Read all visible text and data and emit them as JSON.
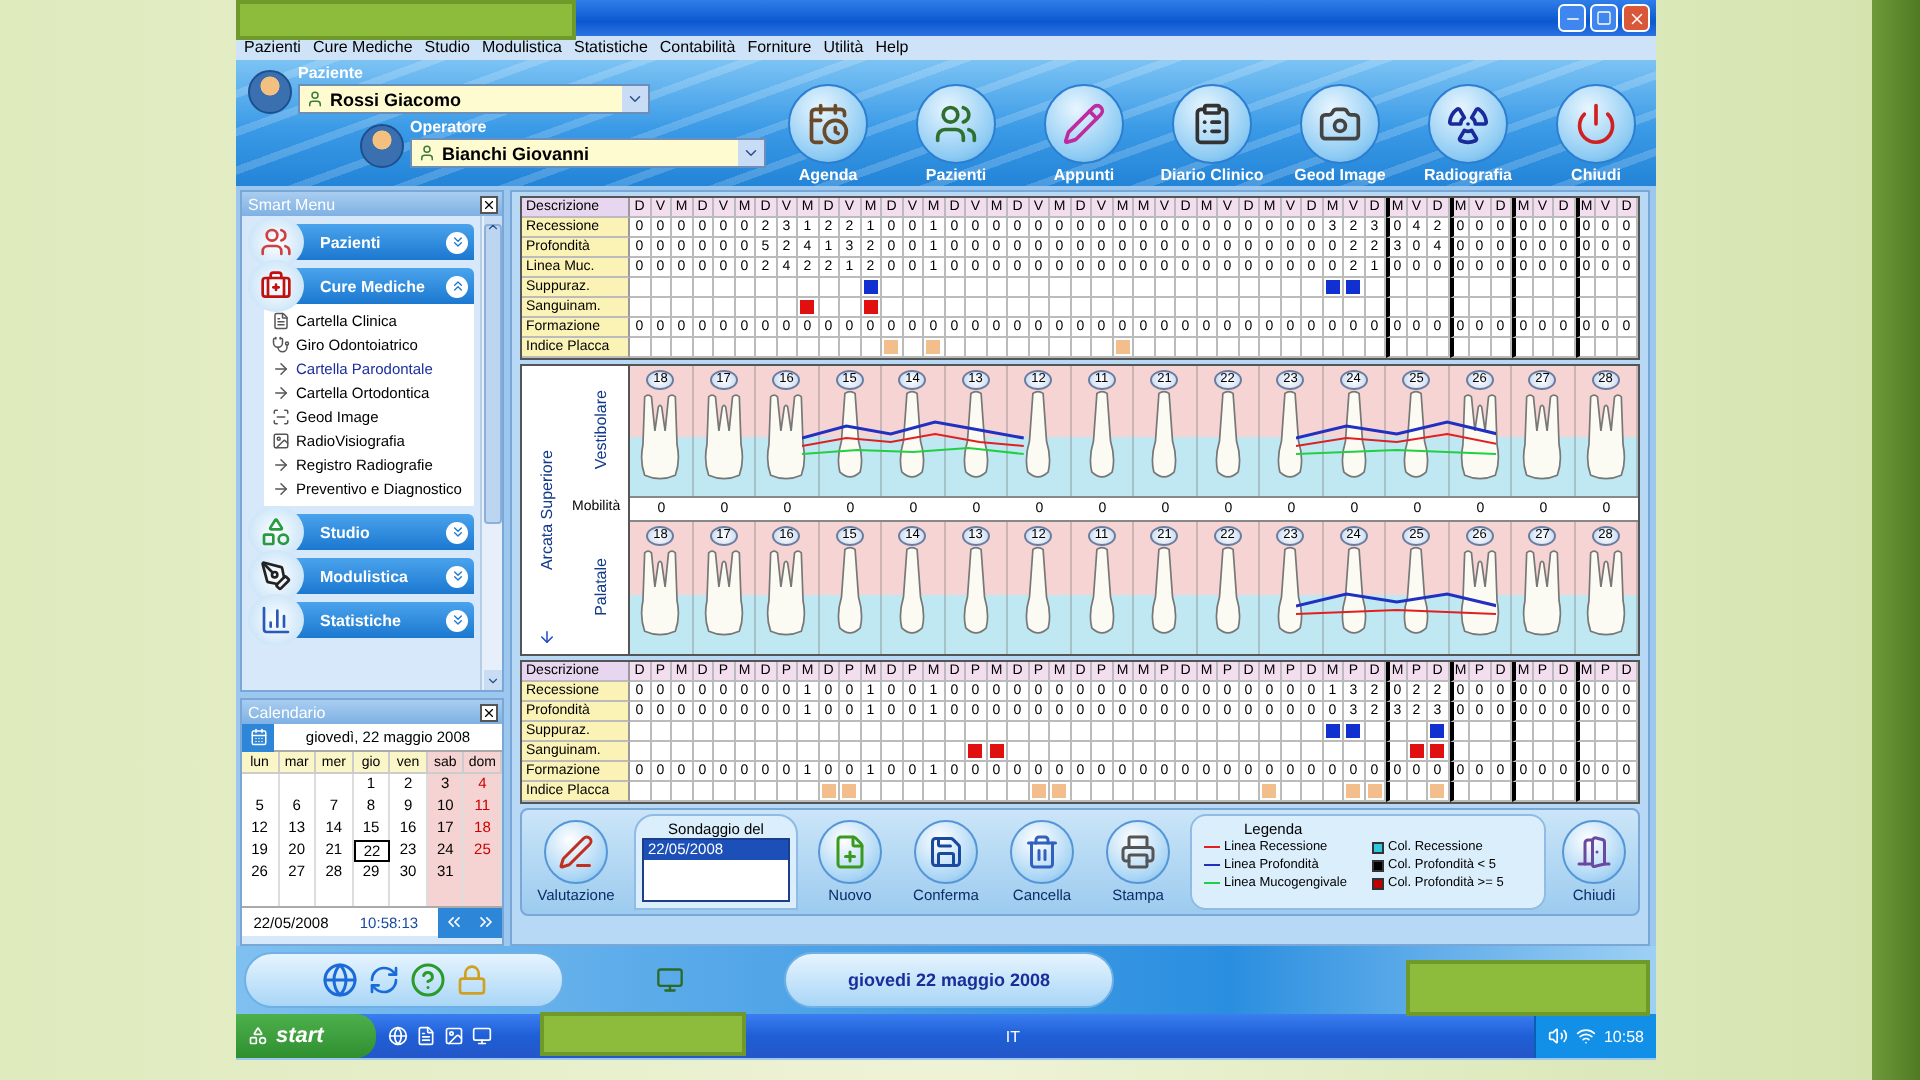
{
  "menu": [
    "Pazienti",
    "Cure Mediche",
    "Studio",
    "Modulistica",
    "Statistiche",
    "Contabilità",
    "Forniture",
    "Utilità",
    "Help"
  ],
  "patient": {
    "label": "Paziente",
    "value": "Rossi Giacomo"
  },
  "operator": {
    "label": "Operatore",
    "value": "Bianchi Giovanni"
  },
  "toolbar": [
    {
      "label": "Agenda",
      "kind": "agenda"
    },
    {
      "label": "Pazienti",
      "kind": "patients"
    },
    {
      "label": "Appunti",
      "kind": "notes"
    },
    {
      "label": "Diario Clinico",
      "kind": "diary"
    },
    {
      "label": "Geod Image",
      "kind": "camera"
    },
    {
      "label": "Radiografia",
      "kind": "xray"
    },
    {
      "label": "Chiudi",
      "kind": "close"
    }
  ],
  "smart_menu": {
    "title": "Smart Menu",
    "groups": [
      {
        "label": "Pazienti",
        "kind": "patients",
        "expanded": false
      },
      {
        "label": "Cure Mediche",
        "kind": "medical",
        "expanded": true,
        "items": [
          {
            "label": "Cartella Clinica",
            "kind": "folder",
            "selected": false
          },
          {
            "label": "Giro Odontoiatrico",
            "kind": "probe",
            "selected": false
          },
          {
            "label": "Cartella Parodontale",
            "kind": "link",
            "selected": true
          },
          {
            "label": "Cartella Ortodontica",
            "kind": "link",
            "selected": false
          },
          {
            "label": "Geod Image",
            "kind": "scan",
            "selected": false
          },
          {
            "label": "RadioVisiografia",
            "kind": "xray",
            "selected": false
          },
          {
            "label": "Registro Radiografie",
            "kind": "link",
            "selected": false
          },
          {
            "label": "Preventivo e Diagnostico",
            "kind": "link",
            "selected": false
          }
        ]
      },
      {
        "label": "Studio",
        "kind": "studio",
        "expanded": false
      },
      {
        "label": "Modulistica",
        "kind": "forms",
        "expanded": false
      },
      {
        "label": "Statistiche",
        "kind": "stats",
        "expanded": false
      }
    ]
  },
  "calendar": {
    "title": "Calendario",
    "heading": "giovedì, 22 maggio 2008",
    "weekdays": [
      "lun",
      "mar",
      "mer",
      "gio",
      "ven",
      "sab",
      "dom"
    ],
    "weeks": [
      [
        {
          "kind": "empty"
        },
        {
          "kind": "empty"
        },
        {
          "kind": "empty"
        },
        {
          "day": "1",
          "selected": false
        },
        {
          "day": "2",
          "selected": false
        },
        {
          "day": "3",
          "selected": false
        },
        {
          "day": "4",
          "selected": false
        }
      ],
      [
        {
          "day": "5",
          "selected": false
        },
        {
          "day": "6",
          "selected": false
        },
        {
          "day": "7",
          "selected": false
        },
        {
          "day": "8",
          "selected": false
        },
        {
          "day": "9",
          "selected": false
        },
        {
          "day": "10",
          "selected": false
        },
        {
          "day": "11",
          "selected": false
        }
      ],
      [
        {
          "day": "12",
          "selected": false
        },
        {
          "day": "13",
          "selected": false
        },
        {
          "day": "14",
          "selected": false
        },
        {
          "day": "15",
          "selected": false
        },
        {
          "day": "16",
          "selected": false
        },
        {
          "day": "17",
          "selected": false
        },
        {
          "day": "18",
          "selected": false
        }
      ],
      [
        {
          "day": "19",
          "selected": false
        },
        {
          "day": "20",
          "selected": false
        },
        {
          "day": "21",
          "selected": false
        },
        {
          "day": "22",
          "selected": true
        },
        {
          "day": "23",
          "selected": false
        },
        {
          "day": "24",
          "selected": false
        },
        {
          "day": "25",
          "selected": false
        }
      ],
      [
        {
          "day": "26",
          "selected": false
        },
        {
          "day": "27",
          "selected": false
        },
        {
          "day": "28",
          "selected": false
        },
        {
          "day": "29",
          "selected": false
        },
        {
          "day": "30",
          "selected": false
        },
        {
          "day": "31",
          "selected": false
        },
        {
          "kind": "empty"
        }
      ],
      [
        {
          "kind": "empty"
        },
        {
          "kind": "empty"
        },
        {
          "kind": "empty"
        },
        {
          "kind": "empty"
        },
        {
          "kind": "empty"
        },
        {
          "kind": "empty"
        },
        {
          "kind": "empty"
        }
      ]
    ],
    "date": "22/05/2008",
    "time": "10:58:13"
  },
  "upper_table": {
    "header": "Descrizione",
    "columns": [
      "D",
      "V",
      "M",
      "D",
      "V",
      "M",
      "D",
      "V",
      "M",
      "D",
      "V",
      "M",
      "D",
      "V",
      "M",
      "D",
      "V",
      "M",
      "D",
      "V",
      "M",
      "D",
      "V",
      "M",
      "M",
      "V",
      "D",
      "M",
      "V",
      "D",
      "M",
      "V",
      "D",
      "M",
      "V",
      "D",
      "M",
      "V",
      "D",
      "M",
      "V",
      "D",
      "M",
      "V",
      "D",
      "M",
      "V",
      "D"
    ],
    "rows": [
      {
        "label": "Recessione",
        "kind": "values",
        "values": [
          "0",
          "0",
          "0",
          "0",
          "0",
          "0",
          "2",
          "3",
          "1",
          "2",
          "2",
          "1",
          "0",
          "0",
          "1",
          "0",
          "0",
          "0",
          "0",
          "0",
          "0",
          "0",
          "0",
          "0",
          "0",
          "0",
          "0",
          "0",
          "0",
          "0",
          "0",
          "0",
          "0",
          "3",
          "2",
          "3",
          "0",
          "4",
          "2",
          "0",
          "0",
          "0",
          "0",
          "0",
          "0",
          "0",
          "0",
          "0"
        ]
      },
      {
        "label": "Profondità",
        "kind": "values",
        "values": [
          "0",
          "0",
          "0",
          "0",
          "0",
          "0",
          "5",
          "2",
          "4",
          "1",
          "3",
          "2",
          "0",
          "0",
          "1",
          "0",
          "0",
          "0",
          "0",
          "0",
          "0",
          "0",
          "0",
          "0",
          "0",
          "0",
          "0",
          "0",
          "0",
          "0",
          "0",
          "0",
          "0",
          "0",
          "2",
          "2",
          "3",
          "0",
          "4",
          "0",
          "0",
          "0",
          "0",
          "0",
          "0",
          "0",
          "0",
          "0"
        ]
      },
      {
        "label": "Linea Muc.",
        "kind": "values",
        "values": [
          "0",
          "0",
          "0",
          "0",
          "0",
          "0",
          "2",
          "4",
          "2",
          "2",
          "1",
          "2",
          "0",
          "0",
          "1",
          "0",
          "0",
          "0",
          "0",
          "0",
          "0",
          "0",
          "0",
          "0",
          "0",
          "0",
          "0",
          "0",
          "0",
          "0",
          "0",
          "0",
          "0",
          "0",
          "2",
          "1",
          "0",
          "0",
          "0",
          "0",
          "0",
          "0",
          "0",
          "0",
          "0",
          "0",
          "0",
          "0"
        ]
      },
      {
        "label": "Suppuraz.",
        "kind": "suppuration",
        "marks": [
          false,
          false,
          false,
          false,
          false,
          false,
          false,
          false,
          false,
          false,
          false,
          true,
          false,
          false,
          false,
          false,
          false,
          false,
          false,
          false,
          false,
          false,
          false,
          false,
          false,
          false,
          false,
          false,
          false,
          false,
          false,
          false,
          false,
          true,
          true,
          false,
          false,
          false,
          false,
          false,
          false,
          false,
          false,
          false,
          false,
          false,
          false,
          false
        ]
      },
      {
        "label": "Sanguinam.",
        "kind": "bleeding",
        "marks": [
          false,
          false,
          false,
          false,
          false,
          false,
          false,
          false,
          true,
          false,
          false,
          true,
          false,
          false,
          false,
          false,
          false,
          false,
          false,
          false,
          false,
          false,
          false,
          false,
          false,
          false,
          false,
          false,
          false,
          false,
          false,
          false,
          false,
          false,
          false,
          false,
          false,
          false,
          false,
          false,
          false,
          false,
          false,
          false,
          false,
          false,
          false,
          false
        ]
      },
      {
        "label": "Formazione",
        "kind": "values",
        "values": [
          "0",
          "0",
          "0",
          "0",
          "0",
          "0",
          "0",
          "0",
          "0",
          "0",
          "0",
          "0",
          "0",
          "0",
          "0",
          "0",
          "0",
          "0",
          "0",
          "0",
          "0",
          "0",
          "0",
          "0",
          "0",
          "0",
          "0",
          "0",
          "0",
          "0",
          "0",
          "0",
          "0",
          "0",
          "0",
          "0",
          "0",
          "0",
          "0",
          "0",
          "0",
          "0",
          "0",
          "0",
          "0",
          "0",
          "0",
          "0"
        ]
      },
      {
        "label": "Indice Placca",
        "kind": "plaque",
        "marks": [
          false,
          false,
          false,
          false,
          false,
          false,
          false,
          false,
          false,
          false,
          false,
          false,
          true,
          false,
          true,
          false,
          false,
          false,
          false,
          false,
          false,
          false,
          false,
          true,
          false,
          false,
          false,
          false,
          false,
          false,
          false,
          false,
          false,
          false,
          false,
          false,
          false,
          false,
          false,
          false,
          false,
          false,
          false,
          false,
          false,
          false,
          false,
          false
        ]
      }
    ]
  },
  "chart": {
    "arch_label": "Arcata Superiore",
    "buccal_label": "Vestibolare",
    "palatal_label": "Palatale",
    "mobility_label": "Mobilità",
    "teeth": [
      {
        "number": "18",
        "mobility": "0",
        "palatal_number": "18"
      },
      {
        "number": "17",
        "mobility": "0",
        "palatal_number": "17"
      },
      {
        "number": "16",
        "mobility": "0",
        "palatal_number": "16"
      },
      {
        "number": "15",
        "mobility": "0",
        "palatal_number": "15"
      },
      {
        "number": "14",
        "mobility": "0",
        "palatal_number": "14"
      },
      {
        "number": "13",
        "mobility": "0",
        "palatal_number": "13"
      },
      {
        "number": "12",
        "mobility": "0",
        "palatal_number": "12"
      },
      {
        "number": "11",
        "mobility": "0",
        "palatal_number": "11"
      },
      {
        "number": "21",
        "mobility": "0",
        "palatal_number": "21"
      },
      {
        "number": "22",
        "mobility": "0",
        "palatal_number": "22"
      },
      {
        "number": "23",
        "mobility": "0",
        "palatal_number": "23"
      },
      {
        "number": "24",
        "mobility": "0",
        "palatal_number": "24"
      },
      {
        "number": "25",
        "mobility": "0",
        "palatal_number": "25"
      },
      {
        "number": "26",
        "mobility": "0",
        "palatal_number": "26"
      },
      {
        "number": "27",
        "mobility": "0",
        "palatal_number": "27"
      },
      {
        "number": "28",
        "mobility": "0",
        "palatal_number": "28"
      }
    ]
  },
  "lower_table": {
    "header": "Descrizione",
    "columns": [
      "D",
      "P",
      "M",
      "D",
      "P",
      "M",
      "D",
      "P",
      "M",
      "D",
      "P",
      "M",
      "D",
      "P",
      "M",
      "D",
      "P",
      "M",
      "D",
      "P",
      "M",
      "D",
      "P",
      "M",
      "M",
      "P",
      "D",
      "M",
      "P",
      "D",
      "M",
      "P",
      "D",
      "M",
      "P",
      "D",
      "M",
      "P",
      "D",
      "M",
      "P",
      "D",
      "M",
      "P",
      "D",
      "M",
      "P",
      "D"
    ],
    "rows": [
      {
        "label": "Recessione",
        "kind": "values",
        "values": [
          "0",
          "0",
          "0",
          "0",
          "0",
          "0",
          "0",
          "0",
          "1",
          "0",
          "0",
          "1",
          "0",
          "0",
          "1",
          "0",
          "0",
          "0",
          "0",
          "0",
          "0",
          "0",
          "0",
          "0",
          "0",
          "0",
          "0",
          "0",
          "0",
          "0",
          "0",
          "0",
          "0",
          "1",
          "3",
          "2",
          "0",
          "2",
          "2",
          "0",
          "0",
          "0",
          "0",
          "0",
          "0",
          "0",
          "0",
          "0"
        ]
      },
      {
        "label": "Profondità",
        "kind": "values",
        "values": [
          "0",
          "0",
          "0",
          "0",
          "0",
          "0",
          "0",
          "0",
          "1",
          "0",
          "0",
          "1",
          "0",
          "0",
          "1",
          "0",
          "0",
          "0",
          "0",
          "0",
          "0",
          "0",
          "0",
          "0",
          "0",
          "0",
          "0",
          "0",
          "0",
          "0",
          "0",
          "0",
          "0",
          "0",
          "3",
          "2",
          "3",
          "2",
          "3",
          "0",
          "0",
          "0",
          "0",
          "0",
          "0",
          "0",
          "0",
          "0"
        ]
      },
      {
        "label": "Suppuraz.",
        "kind": "suppuration",
        "marks": [
          false,
          false,
          false,
          false,
          false,
          false,
          false,
          false,
          false,
          false,
          false,
          false,
          false,
          false,
          false,
          false,
          false,
          false,
          false,
          false,
          false,
          false,
          false,
          false,
          false,
          false,
          false,
          false,
          false,
          false,
          false,
          false,
          false,
          true,
          true,
          false,
          false,
          false,
          true,
          false,
          false,
          false,
          false,
          false,
          false,
          false,
          false,
          false
        ]
      },
      {
        "label": "Sanguinam.",
        "kind": "bleeding",
        "marks": [
          false,
          false,
          false,
          false,
          false,
          false,
          false,
          false,
          false,
          false,
          false,
          false,
          false,
          false,
          false,
          false,
          true,
          true,
          false,
          false,
          false,
          false,
          false,
          false,
          false,
          false,
          false,
          false,
          false,
          false,
          false,
          false,
          false,
          false,
          false,
          false,
          false,
          true,
          true,
          false,
          false,
          false,
          false,
          false,
          false,
          false,
          false,
          false
        ]
      },
      {
        "label": "Formazione",
        "kind": "values",
        "values": [
          "0",
          "0",
          "0",
          "0",
          "0",
          "0",
          "0",
          "0",
          "1",
          "0",
          "0",
          "1",
          "0",
          "0",
          "1",
          "0",
          "0",
          "0",
          "0",
          "0",
          "0",
          "0",
          "0",
          "0",
          "0",
          "0",
          "0",
          "0",
          "0",
          "0",
          "0",
          "0",
          "0",
          "0",
          "0",
          "0",
          "0",
          "0",
          "0",
          "0",
          "0",
          "0",
          "0",
          "0",
          "0",
          "0",
          "0",
          "0"
        ]
      },
      {
        "label": "Indice Placca",
        "kind": "plaque",
        "marks": [
          false,
          false,
          false,
          false,
          false,
          false,
          false,
          false,
          false,
          true,
          true,
          false,
          false,
          false,
          false,
          false,
          false,
          false,
          false,
          true,
          true,
          false,
          false,
          false,
          false,
          false,
          false,
          false,
          false,
          false,
          true,
          false,
          false,
          false,
          true,
          true,
          false,
          false,
          true,
          false,
          false,
          false,
          false,
          false,
          false,
          false,
          false,
          false
        ]
      }
    ]
  },
  "actions": {
    "evaluate": "Valutazione",
    "survey": {
      "label": "Sondaggio del",
      "items": [
        {
          "label": "22/05/2008",
          "selected": true
        }
      ]
    },
    "buttons": [
      {
        "label": "Nuovo",
        "kind": "new"
      },
      {
        "label": "Conferma",
        "kind": "save"
      },
      {
        "label": "Cancella",
        "kind": "delete"
      },
      {
        "label": "Stampa",
        "kind": "print"
      }
    ],
    "legend": {
      "title": "Legenda",
      "items": [
        {
          "label": "Linea Recessione",
          "kind": "line",
          "color": "#e02020"
        },
        {
          "label": "Col. Recessione",
          "kind": "swatch",
          "color": "#30c8e0"
        },
        {
          "label": "Linea Profondità",
          "kind": "line",
          "color": "#2030c0"
        },
        {
          "label": "Col. Profondità < 5",
          "kind": "swatch",
          "color": "#000000"
        },
        {
          "label": "Linea Mucogengivale",
          "kind": "line",
          "color": "#20d040"
        },
        {
          "label": "Col. Profondità >= 5",
          "kind": "swatch",
          "color": "#c00000"
        }
      ]
    },
    "close": "Chiudi"
  },
  "status": {
    "date": "giovedi 22 maggio 2008"
  },
  "taskbar": {
    "start": "start",
    "language": "IT",
    "clock": "10:58"
  }
}
